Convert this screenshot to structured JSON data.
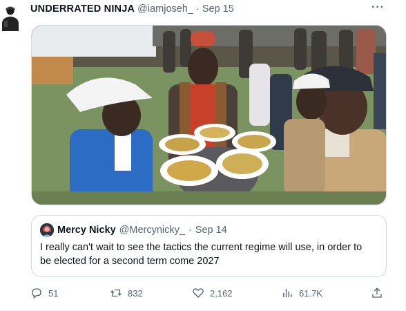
{
  "tweet": {
    "display_name": "UNDERRATED NINJA",
    "handle": "@iamjoseh_",
    "separator": "·",
    "timestamp": "Sep 15",
    "more_icon": "more-icon",
    "more_label": "···"
  },
  "media": {
    "kind": "photo"
  },
  "quote": {
    "display_name": "Mercy Nicky",
    "handle": "@Mercynicky_",
    "separator": "·",
    "timestamp": "Sep 14",
    "text": "I really can't wait to see the tactics the current regime will use, in order to be elected for a second term come 2027"
  },
  "actions": {
    "reply": {
      "icon": "reply-icon",
      "count": "51"
    },
    "retweet": {
      "icon": "retweet-icon",
      "count": "832"
    },
    "like": {
      "icon": "like-icon",
      "count": "2,162"
    },
    "views": {
      "icon": "views-icon",
      "count": "61.7K"
    },
    "share": {
      "icon": "share-icon"
    }
  },
  "colors": {
    "text_primary": "#0f1419",
    "text_secondary": "#536471",
    "border": "#cfd9de"
  }
}
